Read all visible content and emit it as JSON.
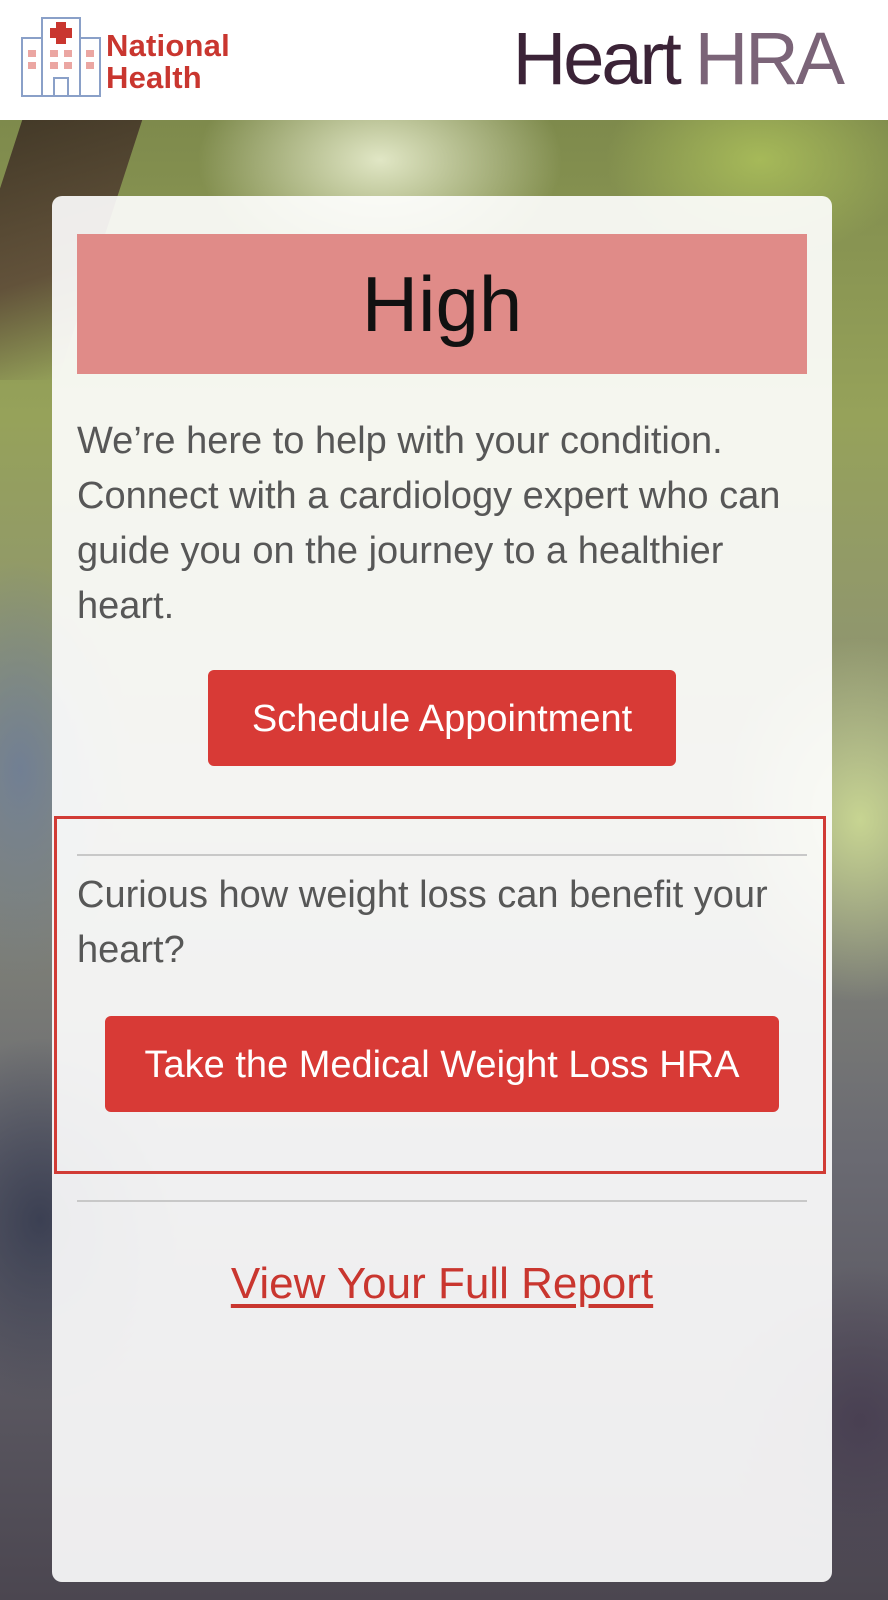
{
  "header": {
    "logo": {
      "line1": "National",
      "line2": "Health",
      "icon": "hospital-building-icon",
      "color": "#c9362f"
    },
    "product_title": {
      "word1": "Heart",
      "word2": "HRA"
    }
  },
  "result": {
    "risk_level": "High",
    "banner_color": "#e08b88",
    "message": "We’re here to help with your condition. Connect with a cardiology expert who can guide you on the journey to a healthier heart.",
    "schedule_button": "Schedule Appointment"
  },
  "weight_loss": {
    "question": "Curious how weight loss can benefit your heart?",
    "button": "Take the Medical Weight Loss HRA",
    "highlight_color": "#d13b35"
  },
  "footer": {
    "report_link": "View Your Full Report"
  },
  "colors": {
    "accent": "#d83a36",
    "title_dark": "#3b2337",
    "title_light": "#7b6478"
  }
}
